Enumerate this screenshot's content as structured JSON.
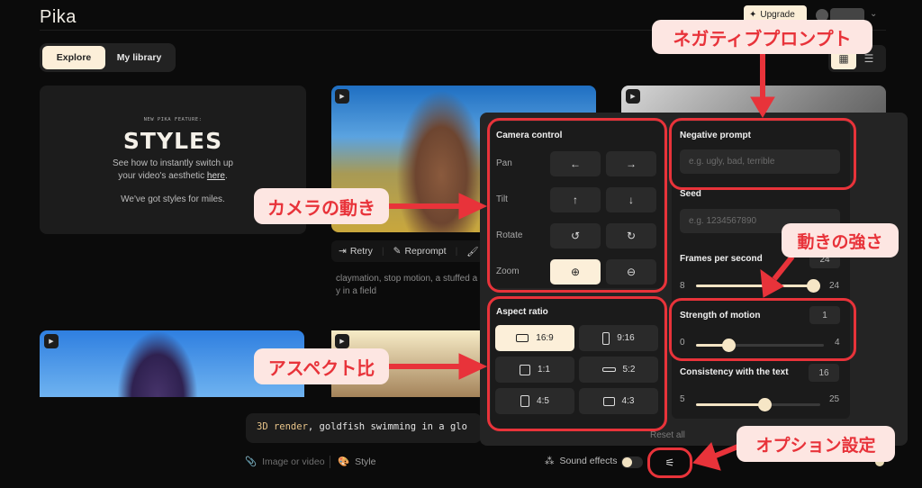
{
  "header": {
    "logo": "Pika",
    "upgrade_label": "Upgrade"
  },
  "nav": {
    "tabs": [
      {
        "label": "Explore",
        "active": true
      },
      {
        "label": "My library",
        "active": false
      }
    ],
    "view_toggle": [
      "grid-view",
      "list-view"
    ]
  },
  "promo": {
    "kicker": "NEW PIKA FEATURE:",
    "title": "STYLES",
    "line1": "See how to instantly switch up",
    "line2_prefix": "your video's aesthetic ",
    "line2_link": "here",
    "line2_suffix": ".",
    "line3": "We've got styles for miles."
  },
  "feed": {
    "actions": [
      "Retry",
      "Reprompt"
    ],
    "caption": "claymation, stop motion, a stuffed a…y in a field",
    "caption_line1": "claymation, stop motion, a stuffed a",
    "caption_line2": "y in a field"
  },
  "options_panel": {
    "camera": {
      "title": "Camera control",
      "rows": [
        {
          "label": "Pan",
          "buttons": [
            "←",
            "→"
          ]
        },
        {
          "label": "Tilt",
          "buttons": [
            "↑",
            "↓"
          ]
        },
        {
          "label": "Rotate",
          "buttons": [
            "↺",
            "↻"
          ]
        },
        {
          "label": "Zoom",
          "buttons": [
            "⊕",
            "⊖"
          ],
          "active": 0
        }
      ]
    },
    "aspect": {
      "title": "Aspect ratio",
      "options": [
        {
          "label": "16:9",
          "active": true
        },
        {
          "label": "9:16"
        },
        {
          "label": "1:1"
        },
        {
          "label": "5:2"
        },
        {
          "label": "4:5"
        },
        {
          "label": "4:3"
        }
      ]
    },
    "negative_prompt": {
      "title": "Negative prompt",
      "placeholder": "e.g. ugly, bad, terrible"
    },
    "seed": {
      "title": "Seed",
      "placeholder": "e.g. 1234567890"
    },
    "fps": {
      "title": "Frames per second",
      "value": "24",
      "min": "8",
      "max": "24",
      "fraction": 1.0
    },
    "motion": {
      "title": "Strength of motion",
      "value": "1",
      "min": "0",
      "max": "4",
      "fraction": 0.25
    },
    "consistency": {
      "title": "Consistency with the text",
      "value": "16",
      "min": "5",
      "max": "25",
      "fraction": 0.55
    },
    "reset_label": "Reset all"
  },
  "composer": {
    "prompt_keyword": "3D render",
    "prompt_rest": ", goldfish swimming in a glo",
    "attach_label": "Image or video",
    "style_label": "Style",
    "sound_label": "Sound effects"
  },
  "annotations": {
    "negative_prompt": "ネガティブプロンプト",
    "camera": "カメラの動き",
    "aspect": "アスペクト比",
    "motion": "動きの強さ",
    "options": "オプション設定",
    "color": "#e8333a"
  }
}
